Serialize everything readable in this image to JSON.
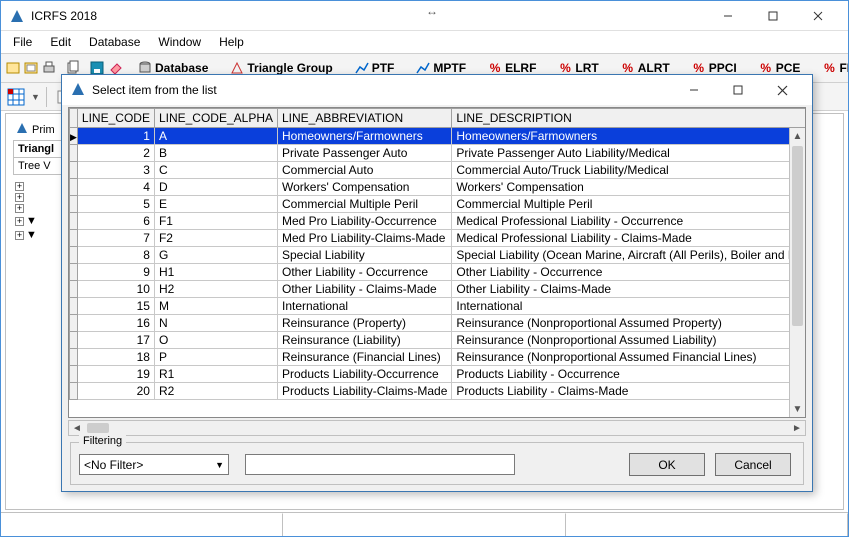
{
  "app": {
    "title": "ICRFS 2018"
  },
  "menus": [
    "File",
    "Edit",
    "Database",
    "Window",
    "Help"
  ],
  "toolbar_tabs": [
    "Database",
    "Triangle Group",
    "PTF",
    "MPTF",
    "ELRF",
    "LRT",
    "ALRT",
    "PPCI",
    "PCE",
    "FL"
  ],
  "side": {
    "prim_label": "Prim",
    "triang_label": "Triangl",
    "tree_label": "Tree V"
  },
  "dialog": {
    "title": "Select item from the list",
    "columns": [
      "LINE_CODE",
      "LINE_CODE_ALPHA",
      "LINE_ABBREVIATION",
      "LINE_DESCRIPTION"
    ],
    "rows": [
      {
        "code": "1",
        "alpha": "A",
        "abbrev": "Homeowners/Farmowners",
        "desc": "Homeowners/Farmowners",
        "selected": true
      },
      {
        "code": "2",
        "alpha": "B",
        "abbrev": "Private Passenger Auto",
        "desc": "Private Passenger Auto Liability/Medical"
      },
      {
        "code": "3",
        "alpha": "C",
        "abbrev": "Commercial Auto",
        "desc": "Commercial Auto/Truck Liability/Medical"
      },
      {
        "code": "4",
        "alpha": "D",
        "abbrev": "Workers' Compensation",
        "desc": "Workers' Compensation"
      },
      {
        "code": "5",
        "alpha": "E",
        "abbrev": "Commercial Multiple Peril",
        "desc": "Commercial Multiple Peril"
      },
      {
        "code": "6",
        "alpha": "F1",
        "abbrev": "Med Pro Liability-Occurrence",
        "desc": "Medical Professional Liability - Occurrence"
      },
      {
        "code": "7",
        "alpha": "F2",
        "abbrev": "Med Pro Liability-Claims-Made",
        "desc": "Medical Professional Liability - Claims-Made"
      },
      {
        "code": "8",
        "alpha": "G",
        "abbrev": "Special Liability",
        "desc": "Special Liability (Ocean Marine, Aircraft (All Perils), Boiler and Machinery)"
      },
      {
        "code": "9",
        "alpha": "H1",
        "abbrev": "Other Liability - Occurrence",
        "desc": "Other Liability - Occurrence"
      },
      {
        "code": "10",
        "alpha": "H2",
        "abbrev": "Other Liability - Claims-Made",
        "desc": "Other Liability - Claims-Made"
      },
      {
        "code": "15",
        "alpha": "M",
        "abbrev": "International",
        "desc": "International"
      },
      {
        "code": "16",
        "alpha": "N",
        "abbrev": "Reinsurance (Property)",
        "desc": "Reinsurance (Nonproportional Assumed Property)"
      },
      {
        "code": "17",
        "alpha": "O",
        "abbrev": "Reinsurance (Liability)",
        "desc": "Reinsurance (Nonproportional Assumed Liability)"
      },
      {
        "code": "18",
        "alpha": "P",
        "abbrev": "Reinsurance (Financial Lines)",
        "desc": "Reinsurance (Nonproportional Assumed Financial Lines)"
      },
      {
        "code": "19",
        "alpha": "R1",
        "abbrev": "Products Liability-Occurrence",
        "desc": "Products Liability - Occurrence"
      },
      {
        "code": "20",
        "alpha": "R2",
        "abbrev": "Products Liability-Claims-Made",
        "desc": "Products Liability - Claims-Made"
      }
    ],
    "filter_legend": "Filtering",
    "filter_value": "<No Filter>",
    "ok_label": "OK",
    "cancel_label": "Cancel"
  }
}
